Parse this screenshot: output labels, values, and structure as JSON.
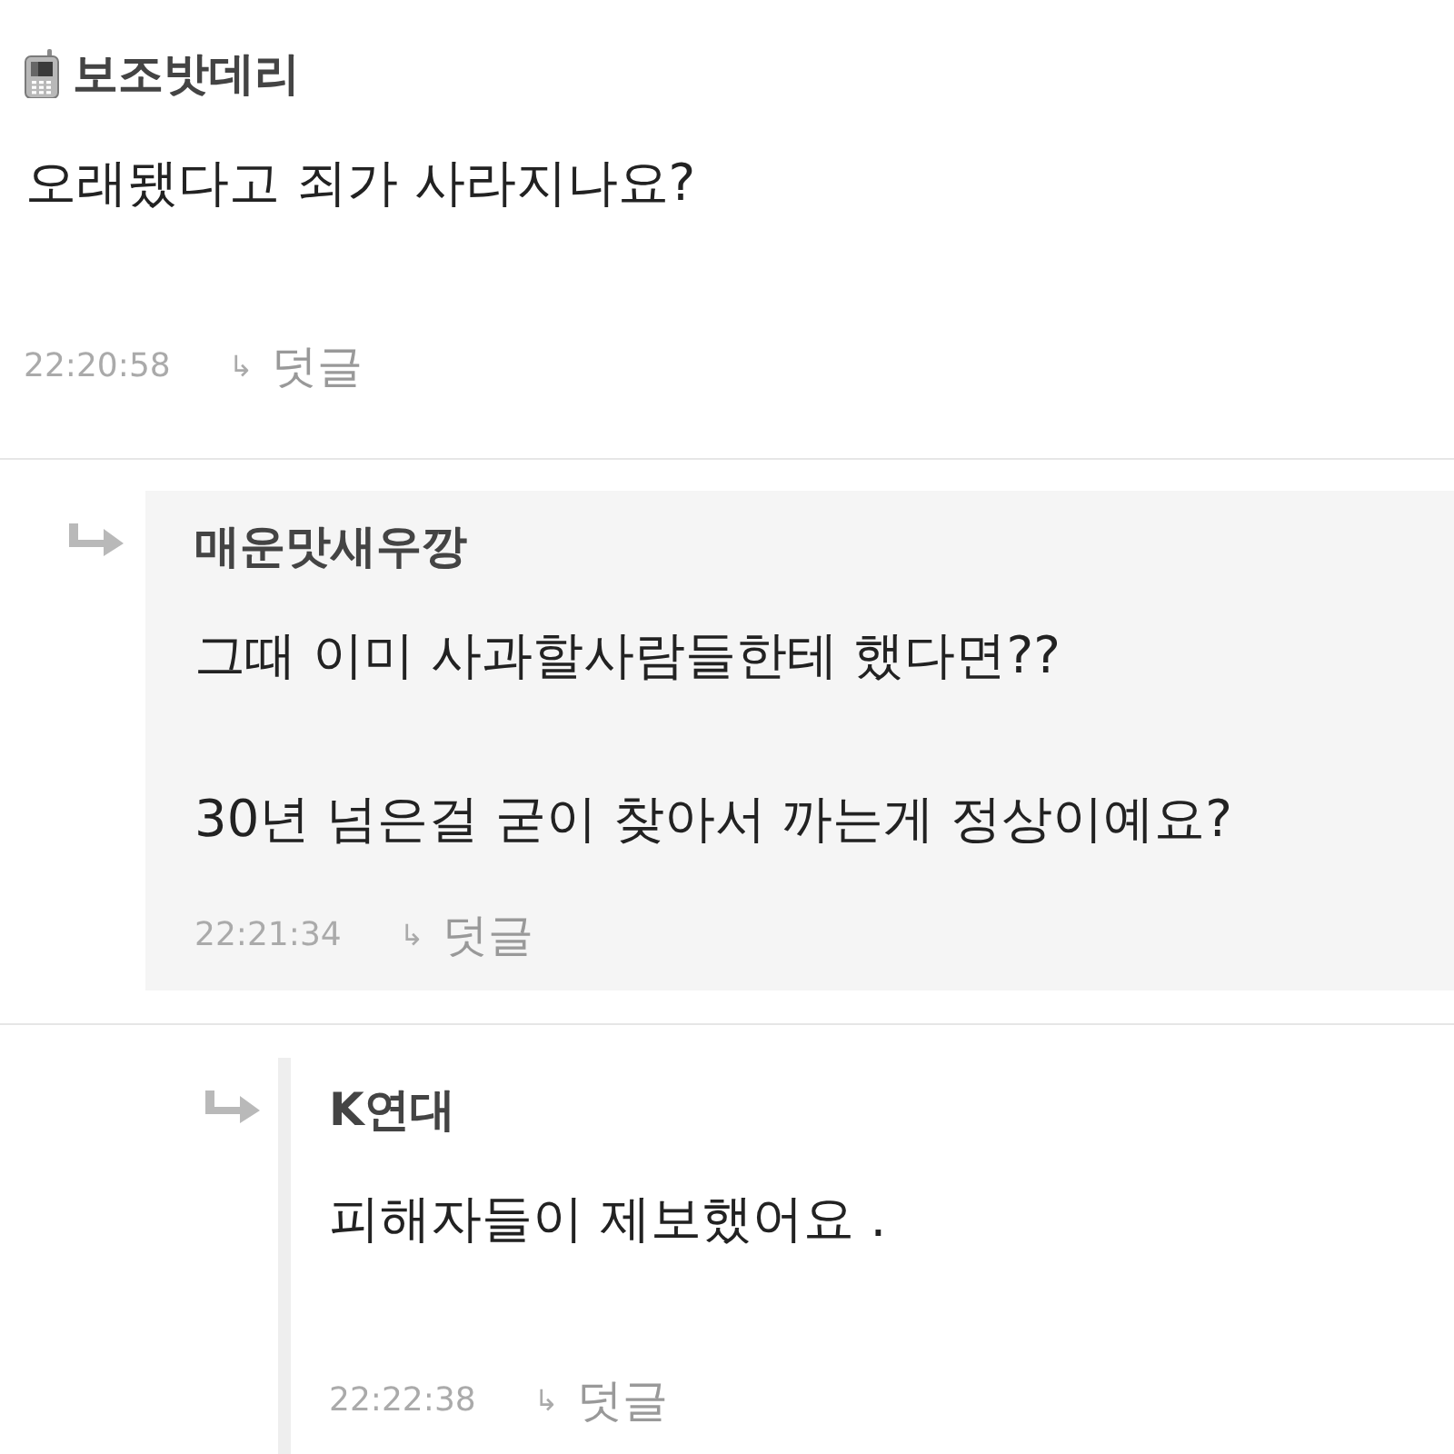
{
  "comments": [
    {
      "author": "보조밧데리",
      "paragraphs": [
        "오래됐다고 죄가 사라지나요?"
      ],
      "time": "22:20:58",
      "reply_link": {
        "mark": "↳",
        "label": "덧글"
      },
      "replies": [
        {
          "author": "매운맛새우깡",
          "paragraphs": [
            "그때 이미 사과할사람들한테 했다면??",
            "30년 넘은걸 굳이 찾아서 까는게 정상이예요?"
          ],
          "time": "22:21:34",
          "reply_link": {
            "mark": "↳",
            "label": "덧글"
          },
          "replies": [
            {
              "author": "K연대",
              "paragraphs": [
                "피해자들이 제보했어요 ."
              ],
              "time": "22:22:38",
              "reply_link": {
                "mark": "↳",
                "label": "덧글"
              }
            }
          ]
        }
      ]
    }
  ]
}
